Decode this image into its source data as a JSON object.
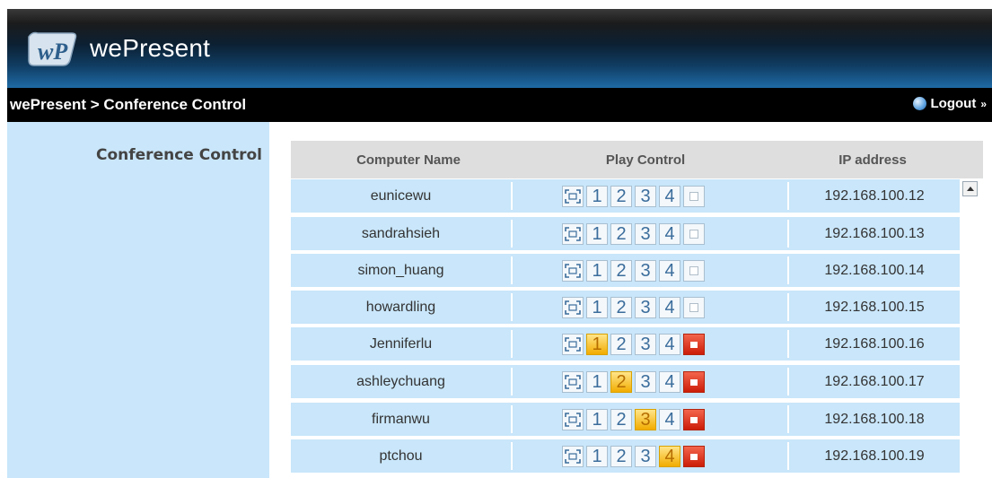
{
  "header": {
    "brand": "wePresent",
    "logo_text": "wP"
  },
  "navbar": {
    "breadcrumb": "wePresent > Conference Control",
    "logout_label": "Logout",
    "logout_suffix": "»"
  },
  "sidebar": {
    "title": "Conference Control"
  },
  "table": {
    "columns": [
      "Computer Name",
      "Play Control",
      "IP address"
    ],
    "play_buttons": [
      "1",
      "2",
      "3",
      "4"
    ],
    "rows": [
      {
        "name": "eunicewu",
        "ip": "192.168.100.12",
        "active_split": null,
        "playing": false
      },
      {
        "name": "sandrahsieh",
        "ip": "192.168.100.13",
        "active_split": null,
        "playing": false
      },
      {
        "name": "simon_huang",
        "ip": "192.168.100.14",
        "active_split": null,
        "playing": false
      },
      {
        "name": "howardling",
        "ip": "192.168.100.15",
        "active_split": null,
        "playing": false
      },
      {
        "name": "Jenniferlu",
        "ip": "192.168.100.16",
        "active_split": 1,
        "playing": true
      },
      {
        "name": "ashleychuang",
        "ip": "192.168.100.17",
        "active_split": 2,
        "playing": true
      },
      {
        "name": "firmanwu",
        "ip": "192.168.100.18",
        "active_split": 3,
        "playing": true
      },
      {
        "name": "ptchou",
        "ip": "192.168.100.19",
        "active_split": 4,
        "playing": true
      }
    ]
  },
  "icons": {
    "fullscreen": "fullscreen-icon",
    "stop": "stop-icon",
    "logout": "globe-icon",
    "scroll_up": "scroll-up-arrow-icon"
  },
  "colors": {
    "panel": "#c9e6fa",
    "selected": "#f2ac00",
    "stop_active": "#cc1d08",
    "nav": "#000000"
  }
}
